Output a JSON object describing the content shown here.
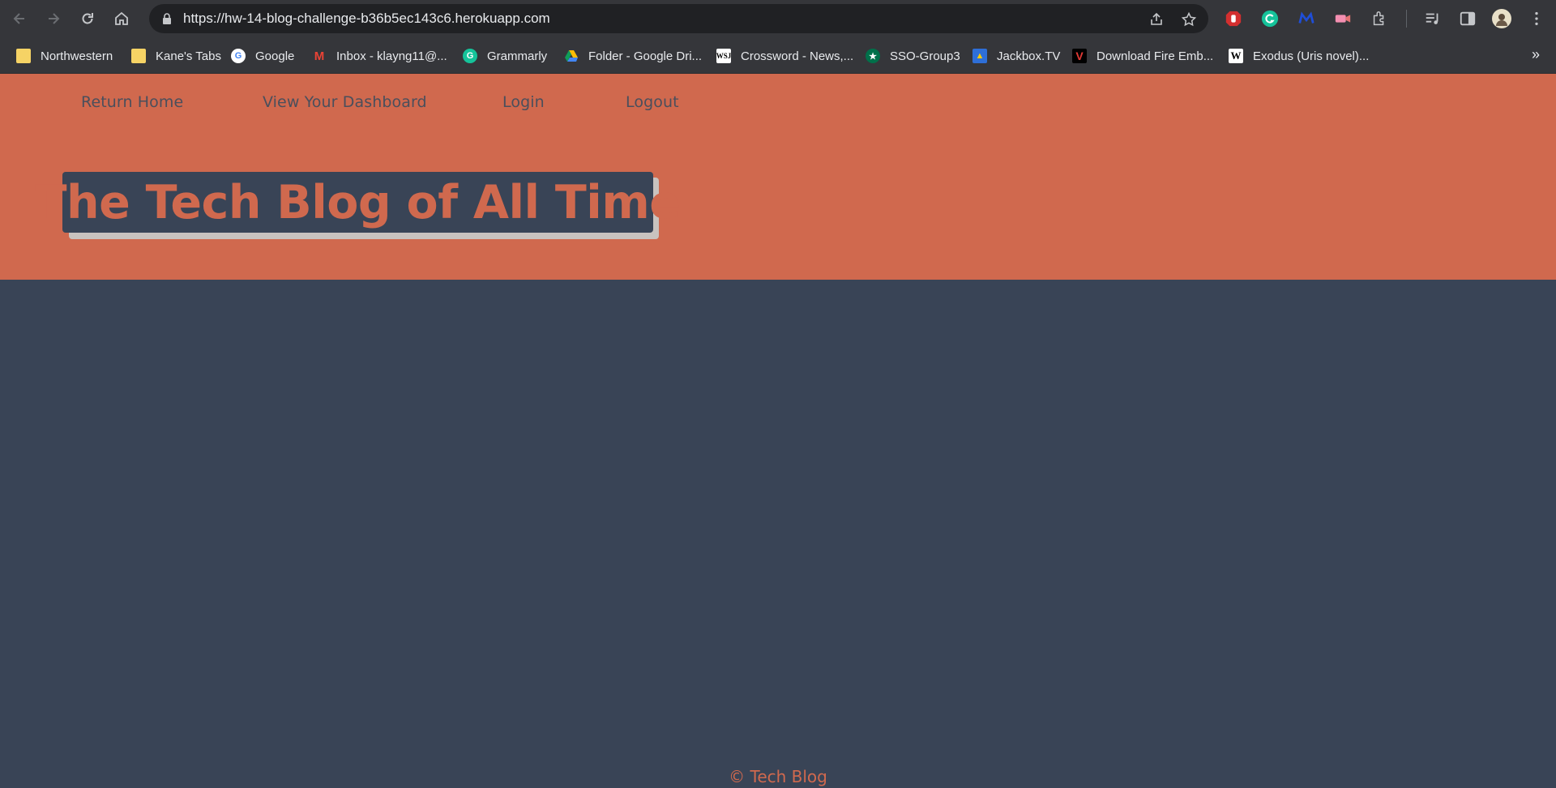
{
  "browser": {
    "url": "https://hw-14-blog-challenge-b36b5ec143c6.herokuapp.com",
    "bookmarks": [
      {
        "label": "Northwestern",
        "icon": "folder-icon"
      },
      {
        "label": "Kane's Tabs",
        "icon": "folder-icon"
      },
      {
        "label": "Google",
        "icon": "google-icon"
      },
      {
        "label": "Inbox - klayng11@...",
        "icon": "gmail-icon"
      },
      {
        "label": "Grammarly",
        "icon": "grammarly-icon"
      },
      {
        "label": "Folder - Google Dri...",
        "icon": "google-drive-icon"
      },
      {
        "label": "Crossword - News,...",
        "icon": "wsj-icon"
      },
      {
        "label": "SSO-Group3",
        "icon": "starbucks-icon"
      },
      {
        "label": "Jackbox.TV",
        "icon": "jackbox-icon"
      },
      {
        "label": "Download Fire Emb...",
        "icon": "vimm-icon"
      },
      {
        "label": "Exodus (Uris novel)...",
        "icon": "wikipedia-icon"
      }
    ],
    "more_bookmarks": "»"
  },
  "nav": {
    "home": "Return Home",
    "dashboard": "View Your Dashboard",
    "login": "Login",
    "logout": "Logout"
  },
  "header": {
    "title": "The Tech Blog of All Time"
  },
  "footer": {
    "text": "© Tech Blog"
  },
  "colors": {
    "accent": "#d0694e",
    "background": "#394456",
    "title_shadow": "#c9c3bf",
    "nav_text": "#4a4f5c"
  }
}
